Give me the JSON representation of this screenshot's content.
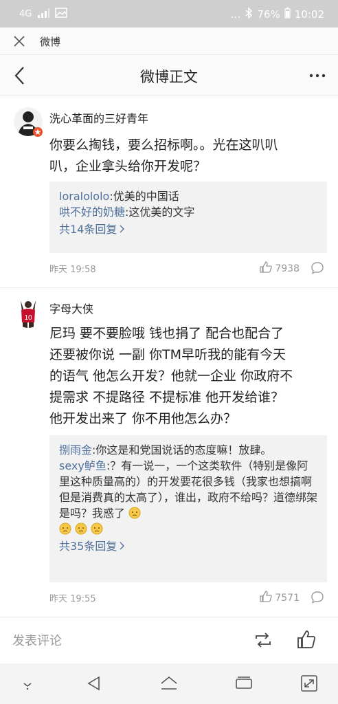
{
  "status_bar": {
    "network": "4G",
    "battery": "76%",
    "time": "10:02",
    "dots": "…"
  },
  "browser": {
    "title": "微博"
  },
  "nav": {
    "title": "微博正文"
  },
  "comments": [
    {
      "username": "洗心革面的三好青年",
      "content": "你要么掏钱，要么招标啊。。光在这叭叭\n叭，企业拿头给你开发呢？",
      "replies": [
        {
          "user": "loralololo",
          "text": ":优美的中国话"
        },
        {
          "user": "哄不好的奶糖",
          "text": ":这优美的文字"
        }
      ],
      "more_replies": "共14条回复",
      "time": "昨天 19:58",
      "likes": "7938"
    },
    {
      "username": "字母大侠",
      "content": "尼玛 要不要脸哦 钱也捐了 配合也配合了\n还要被你说 一副 你TM早听我的能有今天\n的语气 他怎么开发？他就一企业 你政府不\n提需求 不提路径 不提标准 他开发给谁？\n他开发出来了 你不用他怎么办？",
      "replies": [
        {
          "user": "捌雨金",
          "text": ":你这是和党国说话的态度嘛！放肆。"
        },
        {
          "user": "sexy鲈鱼",
          "text": ":？有一说一，一个这类软件（特别是像阿里这种质量高的）的开发要花很多钱（我家也想搞啊但是消费真的太高了），谁出，政府不给吗？道德绑架是吗？我惑了"
        }
      ],
      "more_replies": "共35条回复",
      "time": "昨天 19:55",
      "likes": "7571"
    }
  ],
  "bottom": {
    "input_placeholder": "发表评论"
  },
  "colors": {
    "link": "#4e6f9b",
    "status_bar": "#cfcfcf",
    "reply_bg": "#f2f2f2",
    "badge": "#e8512b"
  }
}
